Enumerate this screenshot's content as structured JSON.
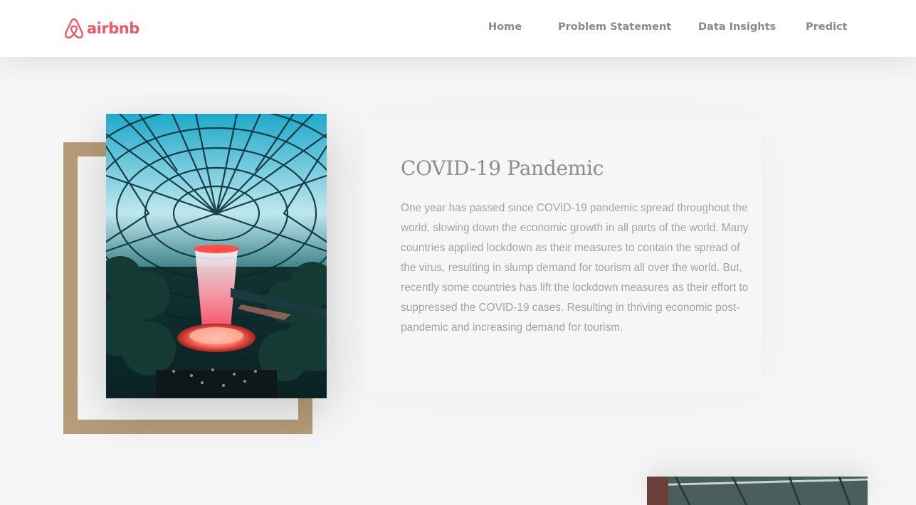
{
  "header": {
    "logo_text": "airbnb",
    "nav": [
      {
        "label": "Home"
      },
      {
        "label": "Problem Statement"
      },
      {
        "label": "Data Insights"
      },
      {
        "label": "Predict"
      }
    ]
  },
  "section": {
    "title": "COVID-19 Pandemic",
    "body": "One year has passed since COVID-19 pandemic spread throughout the world, slowing down the economic growth in all parts of the world. Many countries applied lockdown as their measures to contain the spread of the virus, resulting in slump demand for tourism all over the world. But, recently some countries has lift the lockdown measures as their effort to suppressed the COVID-19 cases. Resulting in thriving economic post-pandemic and increasing demand for tourism."
  },
  "colors": {
    "brand": "#f0586a",
    "frame": "#b69d78",
    "nav_text": "#8a8a8a",
    "heading": "#8d8d8d",
    "body_text": "#a3a3a3"
  }
}
